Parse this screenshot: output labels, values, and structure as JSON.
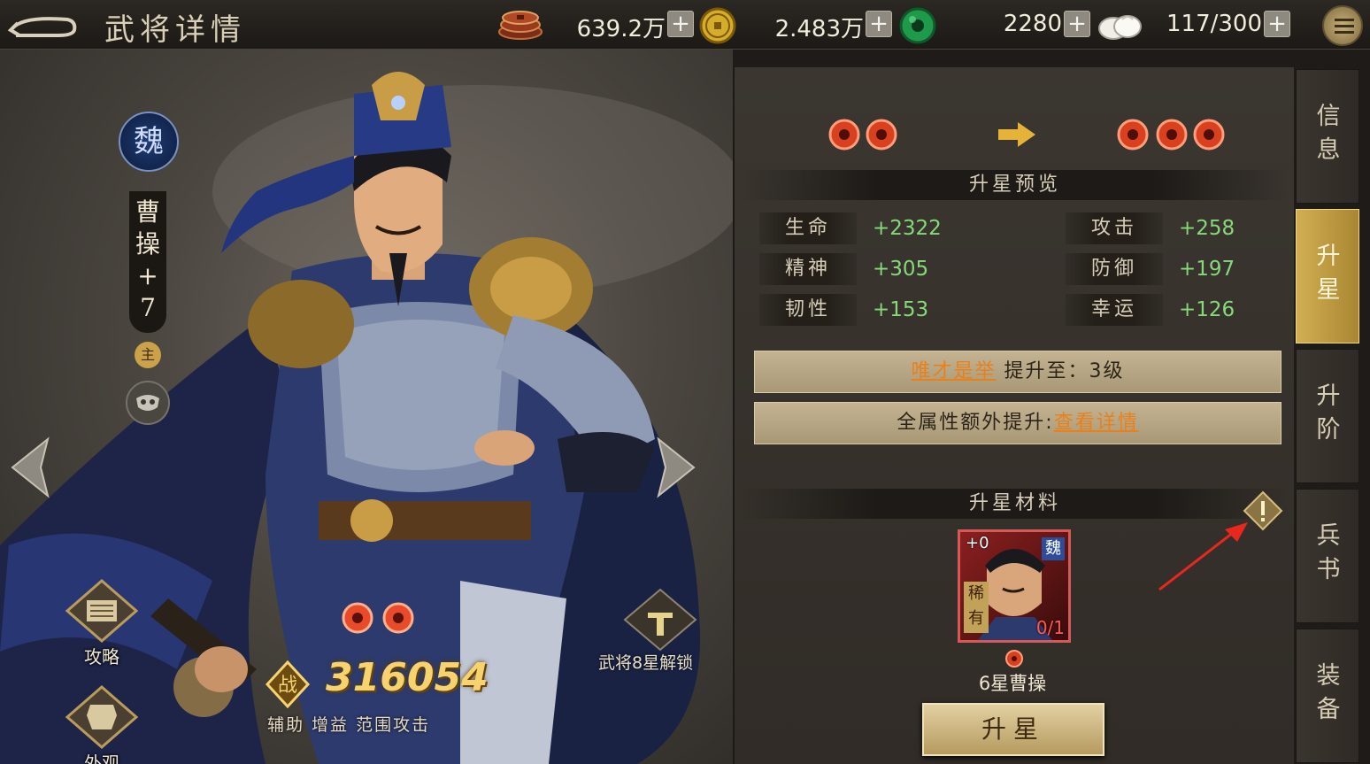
{
  "header": {
    "title": "武将详情",
    "resources": [
      {
        "icon": "copper-coins-icon",
        "value": "639.2万"
      },
      {
        "icon": "gold-coin-icon",
        "value": "2.483万"
      },
      {
        "icon": "jade-icon",
        "value": "2280"
      },
      {
        "icon": "buns-stamina-icon",
        "value": "117/300"
      }
    ],
    "plus": "+"
  },
  "hero": {
    "faction": "魏",
    "name_chars": [
      "曹",
      "操",
      "+",
      "7"
    ],
    "role_tag": "主",
    "current_stars": 2,
    "power": "316054",
    "tags": "辅助 增益 范围攻击",
    "unlock_label": "武将8星解锁",
    "side_buttons": {
      "strategy": "攻略",
      "appearance": "外观"
    }
  },
  "upgrade": {
    "from_stars": 2,
    "to_stars": 3,
    "preview_title": "升星预览",
    "stats": [
      {
        "label": "生命",
        "value": "+2322"
      },
      {
        "label": "攻击",
        "value": "+258"
      },
      {
        "label": "精神",
        "value": "+305"
      },
      {
        "label": "防御",
        "value": "+197"
      },
      {
        "label": "韧性",
        "value": "+153"
      },
      {
        "label": "幸运",
        "value": "+126"
      }
    ],
    "skill_link": "唯才是举",
    "skill_text": "提升至：3级",
    "bonus_text": "全属性额外提升:",
    "bonus_link": "查看详情",
    "materials_title": "升星材料",
    "material": {
      "plus": "+0",
      "faction": "魏",
      "rarity": "稀有",
      "count": "0/1",
      "name": "6星曹操"
    },
    "button": "升星"
  },
  "tabs": [
    {
      "label": [
        "信",
        "息"
      ],
      "active": false
    },
    {
      "label": [
        "升",
        "星"
      ],
      "active": true
    },
    {
      "label": [
        "升",
        "阶"
      ],
      "active": false
    },
    {
      "label": [
        "兵",
        "书"
      ],
      "active": false
    },
    {
      "label": [
        "装",
        "备"
      ],
      "active": false
    }
  ],
  "colors": {
    "accent_gold": "#c9a24a",
    "stat_green": "#86d97a",
    "link_orange": "#e8811c",
    "power_yellow": "#f6d36f"
  }
}
